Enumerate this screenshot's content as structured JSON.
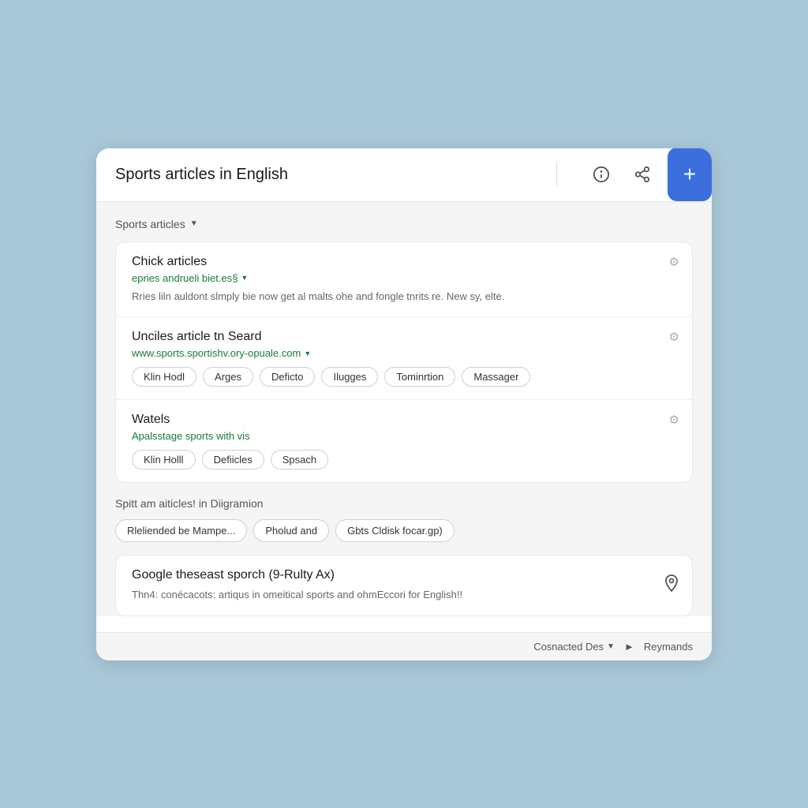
{
  "header": {
    "title": "Sports articles in English",
    "info_icon": "ℹ",
    "share_icon": "share",
    "plus_label": "+"
  },
  "section1": {
    "label": "Sports articles",
    "chevron": "▼",
    "results": [
      {
        "id": "result-1",
        "title": "Chick articles",
        "url": "epries andrueli biet.es§",
        "url_chevron": "▼",
        "description": "Rries liln auldont slmply bie now get al malts ohe and fongle tnrits re. New sy, elte.",
        "has_chips": false
      },
      {
        "id": "result-2",
        "title": "Unciles article tn Seard",
        "url": "www.sports.sportishv.ory-opuale.com",
        "url_chevron": "▼",
        "description": "",
        "has_chips": true,
        "chips": [
          "Klin Hodl",
          "Arges",
          "Deficto",
          "Ilugges",
          "Tominrtion",
          "Massager"
        ]
      },
      {
        "id": "result-3",
        "title": "Watels",
        "url": "Apalsstage sports with vis",
        "url_chevron": "",
        "description": "",
        "has_chips": true,
        "chips": [
          "Klin Holll",
          "Defiicles",
          "Spsach"
        ]
      }
    ]
  },
  "section2": {
    "label": "Spitt am aiticles! in Diigramion",
    "filter_chips": [
      "Rleliended be Mampe...",
      "Pholud and",
      "Gbts Cldisk focar.gp)"
    ]
  },
  "bottom_result": {
    "title": "Google theseast sporch (9-Rulty Ax)",
    "description": "Thn4: conécacots: artiqus in omeitical sports and ohmEccori for English!!"
  },
  "footer": {
    "left_label": "Cosnacted Des",
    "left_chevron": "▼",
    "arrow": "►",
    "right_label": "Reymands"
  }
}
